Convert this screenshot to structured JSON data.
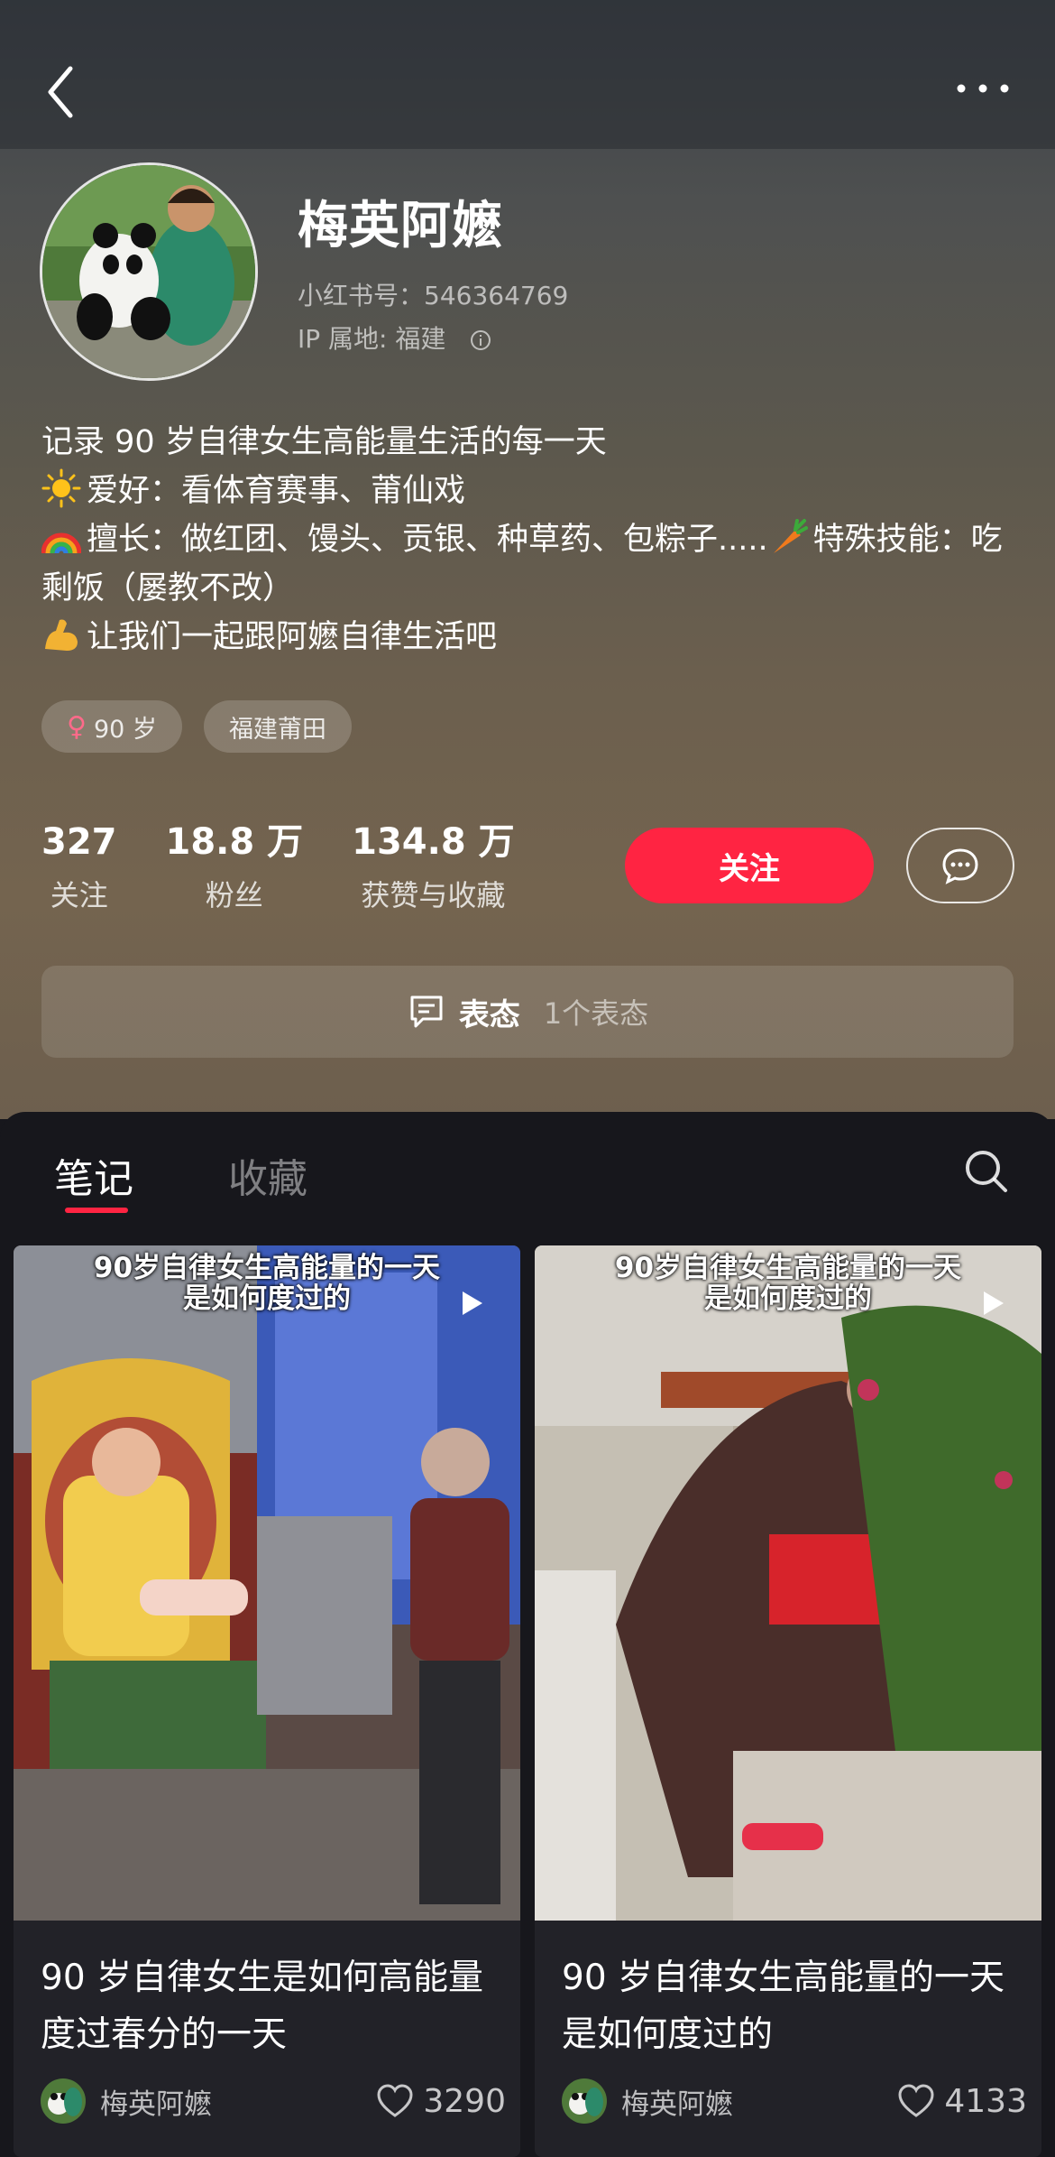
{
  "profile": {
    "nickname": "梅英阿嬷",
    "id_text": "小红书号：546364769",
    "ip_text": "IP 属地: 福建",
    "bio": [
      {
        "emoji": "sun",
        "text": "记录 90 岁自律女生高能量生活的每一天"
      },
      {
        "emoji": "sun",
        "text": "爱好：看体育赛事、莆仙戏"
      },
      {
        "emoji": "rainbow",
        "text": "擅长：做红团、馒头、贡银、种草药、包粽子.....",
        "emoji2": "carrot",
        "text2": "特殊技能：吃剩饭（屡教不改）"
      },
      {
        "emoji": "muscle",
        "text": "让我们一起跟阿嬷自律生活吧"
      }
    ],
    "tags": [
      "90 岁",
      "福建莆田"
    ]
  },
  "stats": [
    {
      "num": "327",
      "label": "关注"
    },
    {
      "num": "18.8 万",
      "label": "粉丝"
    },
    {
      "num": "134.8 万",
      "label": "获赞与收藏"
    }
  ],
  "actions": {
    "follow_label": "关注"
  },
  "attitude": {
    "title": "表态",
    "count": "1个表态"
  },
  "tabs": {
    "notes": "笔记",
    "collections": "收藏"
  },
  "notes": [
    {
      "cover_line1": "90岁自律女生高能量的一天",
      "cover_line2": "是如何度过的",
      "title": "90 岁自律女生是如何高能量度过春分的一天",
      "author": "梅英阿嬷",
      "likes": "3290"
    },
    {
      "cover_line1": "90岁自律女生高能量的一天",
      "cover_line2": "是如何度过的",
      "title": "90 岁自律女生高能量的一天是如何度过的",
      "author": "梅英阿嬷",
      "likes": "4133"
    }
  ],
  "colors": {
    "accent": "#ff2442",
    "panel": "#17171c"
  }
}
